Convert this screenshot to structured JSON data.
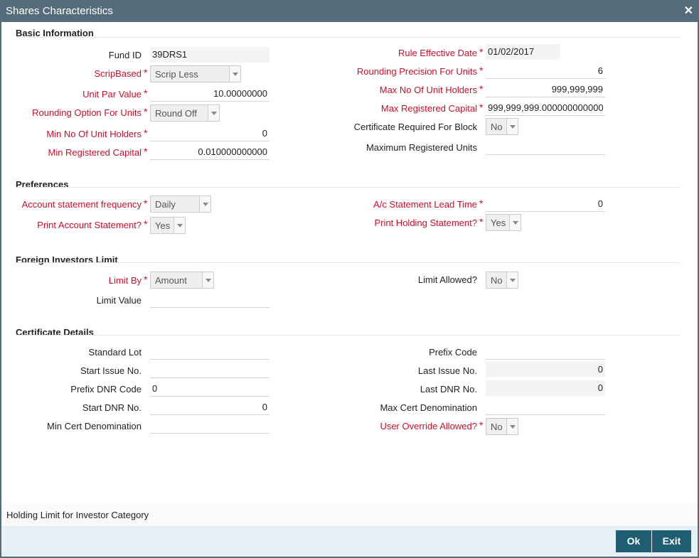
{
  "window": {
    "title": "Shares Characteristics",
    "close_glyph": "✕"
  },
  "required_marker": "*",
  "sections": {
    "basic": "Basic Information",
    "preferences": "Preferences",
    "foreign": "Foreign Investors Limit",
    "certificate": "Certificate Details"
  },
  "basic": {
    "fund_id": {
      "label": "Fund ID",
      "value": "39DRS1"
    },
    "scrip_based": {
      "label": "ScripBased",
      "value": "Scrip Less"
    },
    "unit_par_value": {
      "label": "Unit Par Value",
      "value": "10.00000000"
    },
    "rounding_option": {
      "label": "Rounding Option For Units",
      "value": "Round Off"
    },
    "min_unit_holders": {
      "label": "Min No Of Unit Holders",
      "value": "0"
    },
    "min_registered_capital": {
      "label": "Min Registered Capital",
      "value": "0.010000000000"
    },
    "rule_effective_date": {
      "label": "Rule Effective Date",
      "value": "01/02/2017"
    },
    "rounding_precision": {
      "label": "Rounding Precision For Units",
      "value": "6"
    },
    "max_unit_holders": {
      "label": "Max No Of Unit Holders",
      "value": "999,999,999"
    },
    "max_registered_capital": {
      "label": "Max Registered Capital",
      "value": "999,999,999.000000000000"
    },
    "certificate_required": {
      "label": "Certificate Required For Block",
      "value": "No"
    },
    "max_registered_units": {
      "label": "Maximum Registered Units",
      "value": ""
    }
  },
  "preferences": {
    "account_statement_frequency": {
      "label": "Account statement frequency",
      "value": "Daily"
    },
    "print_account_statement": {
      "label": "Print Account Statement?",
      "value": "Yes"
    },
    "ac_statement_lead_time": {
      "label": "A/c Statement Lead Time",
      "value": "0"
    },
    "print_holding_statement": {
      "label": "Print Holding Statement?",
      "value": "Yes"
    }
  },
  "foreign": {
    "limit_by": {
      "label": "Limit By",
      "value": "Amount"
    },
    "limit_value": {
      "label": "Limit Value",
      "value": ""
    },
    "limit_allowed": {
      "label": "Limit Allowed?",
      "value": "No"
    }
  },
  "certificate": {
    "standard_lot": {
      "label": "Standard Lot",
      "value": ""
    },
    "start_issue_no": {
      "label": "Start Issue No.",
      "value": ""
    },
    "prefix_dnr_code": {
      "label": "Prefix DNR Code",
      "value": "0"
    },
    "start_dnr_no": {
      "label": "Start DNR No.",
      "value": "0"
    },
    "min_cert_denomination": {
      "label": "Min Cert Denomination",
      "value": ""
    },
    "prefix_code": {
      "label": "Prefix Code",
      "value": ""
    },
    "last_issue_no": {
      "label": "Last Issue No.",
      "value": "0"
    },
    "last_dnr_no": {
      "label": "Last DNR No.",
      "value": "0"
    },
    "max_cert_denomination": {
      "label": "Max Cert Denomination",
      "value": ""
    },
    "user_override_allowed": {
      "label": "User Override Allowed?",
      "value": "No"
    }
  },
  "bottom_link": "Holding Limit for Investor Category",
  "buttons": {
    "ok": "Ok",
    "exit": "Exit"
  },
  "colors": {
    "titlebar": "#556c7b",
    "required": "#c8102e",
    "button": "#1f5d73",
    "footer": "#e7f0f5"
  }
}
